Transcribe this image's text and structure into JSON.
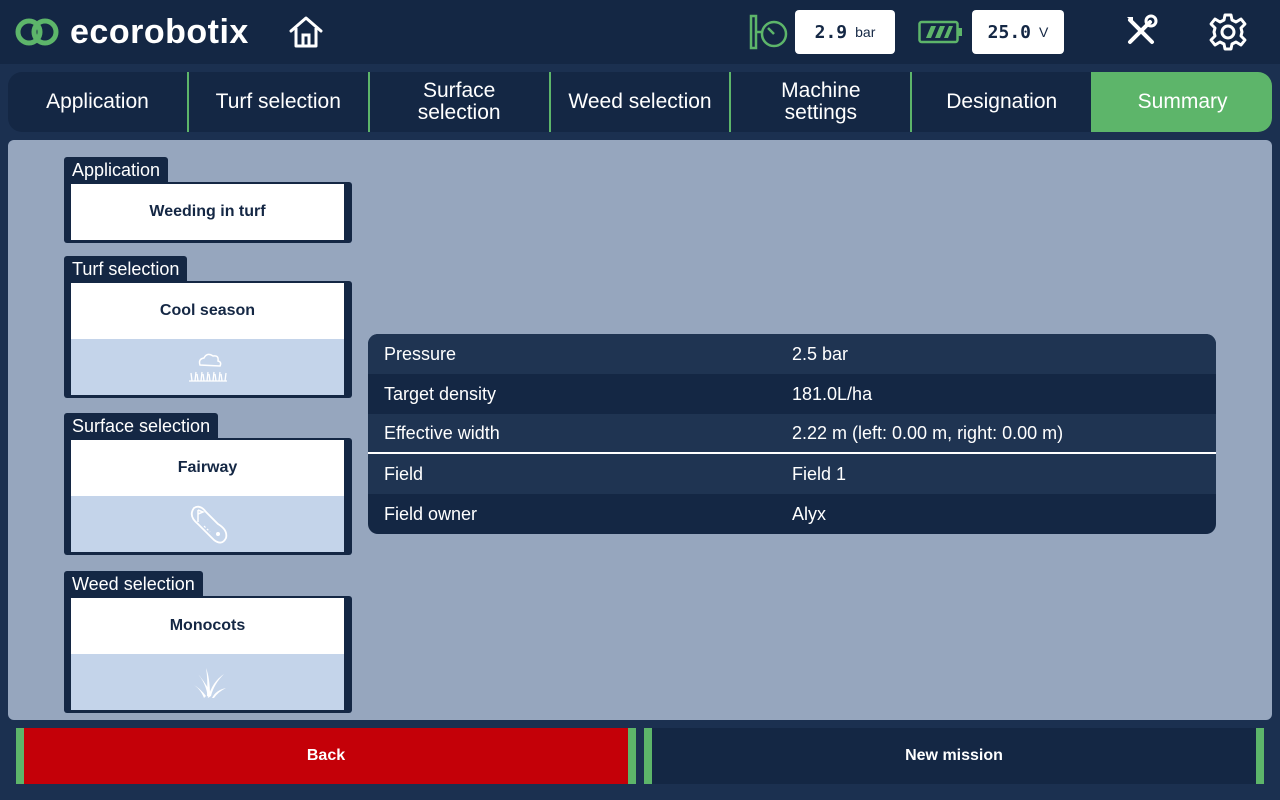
{
  "header": {
    "brand": "ecorobotix",
    "pressure": {
      "value": "2.9",
      "unit": "bar"
    },
    "voltage": {
      "value": "25.0",
      "unit": "V"
    },
    "colors": {
      "accent": "#5db56a",
      "dark": "#142744"
    }
  },
  "tabs": [
    {
      "label": "Application"
    },
    {
      "label": "Turf selection"
    },
    {
      "label": "Surface\nselection"
    },
    {
      "label": "Weed selection"
    },
    {
      "label": "Machine\nsettings"
    },
    {
      "label": "Designation"
    },
    {
      "label": "Summary",
      "active": true
    }
  ],
  "cards": [
    {
      "label": "Application",
      "value": "Weeding in turf"
    },
    {
      "label": "Turf selection",
      "value": "Cool season",
      "icon": "cloud-grass-icon"
    },
    {
      "label": "Surface selection",
      "value": "Fairway",
      "icon": "fairway-icon"
    },
    {
      "label": "Weed selection",
      "value": "Monocots",
      "icon": "monocot-icon"
    }
  ],
  "summary": [
    {
      "key": "Pressure",
      "value": "2.5 bar"
    },
    {
      "key": "Target density",
      "value": "181.0L/ha"
    },
    {
      "key": "Effective width",
      "value": "2.22 m (left: 0.00 m, right: 0.00 m)"
    },
    {
      "key": "Field",
      "value": "Field 1"
    },
    {
      "key": "Field owner",
      "value": "Alyx"
    }
  ],
  "buttons": {
    "back": "Back",
    "new_mission": "New mission"
  }
}
